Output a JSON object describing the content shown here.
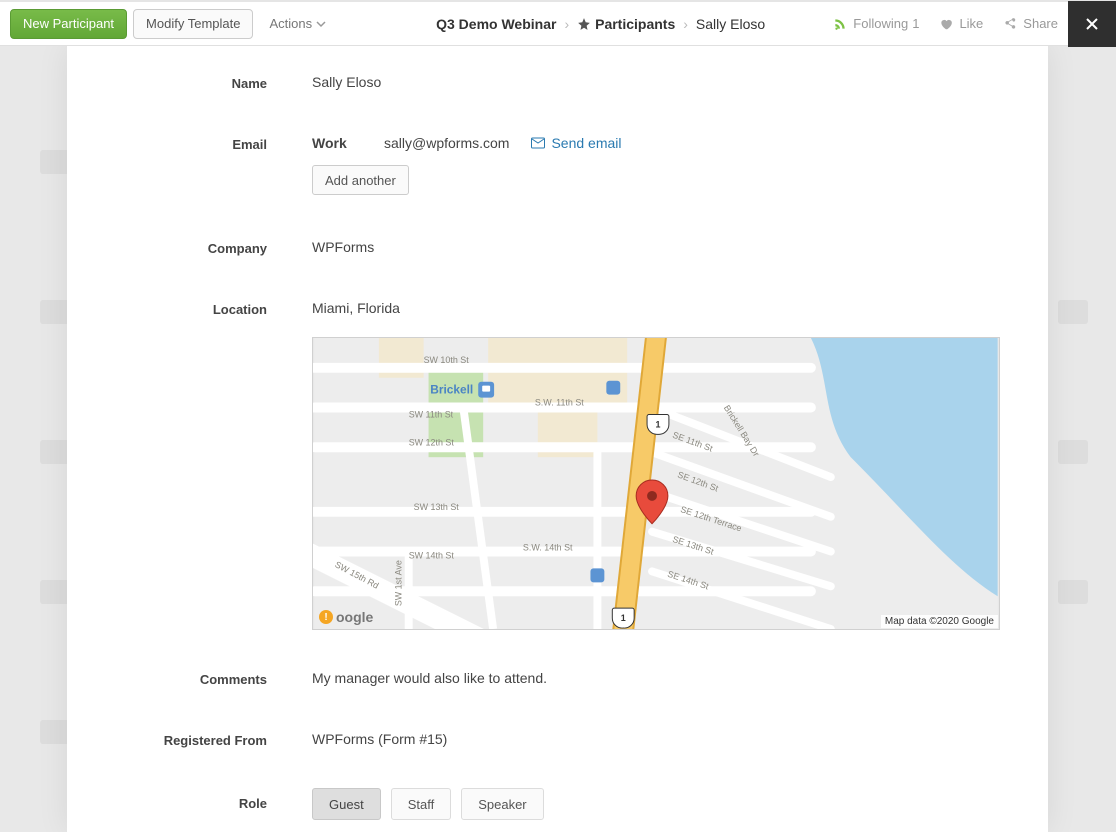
{
  "toolbar": {
    "new_label": "New Participant",
    "modify_label": "Modify Template",
    "actions_label": "Actions"
  },
  "breadcrumb": {
    "root": "Q3 Demo Webinar",
    "section": "Participants",
    "leaf": "Sally Eloso"
  },
  "right": {
    "following_label": "Following",
    "following_count": "1",
    "like_label": "Like",
    "share_label": "Share"
  },
  "fields": {
    "name_label": "Name",
    "name_value": "Sally Eloso",
    "email_label": "Email",
    "email_type": "Work",
    "email_value": "sally@wpforms.com",
    "send_email": "Send email",
    "add_another": "Add another",
    "company_label": "Company",
    "company_value": "WPForms",
    "location_label": "Location",
    "location_value": "Miami, Florida",
    "comments_label": "Comments",
    "comments_value": "My manager would also like to attend.",
    "registered_from_label": "Registered From",
    "registered_from_value": "WPForms (Form #15)",
    "role_label": "Role"
  },
  "roles": {
    "guest": "Guest",
    "staff": "Staff",
    "speaker": "Speaker"
  },
  "map": {
    "station": "Brickell",
    "attribution": "Map data ©2020 Google",
    "logo": "oogle",
    "streets": {
      "sw10": "SW 10th St",
      "sw11": "SW 11th St",
      "sw11b": "S.W. 11th St",
      "sw12": "SW 12th St",
      "sw13": "SW 13th St",
      "sw14": "SW 14th St",
      "sw14b": "S.W. 14th St",
      "sw15rd": "SW 15th Rd",
      "se11": "SE 11th St",
      "se12": "SE 12th St",
      "se12ter": "SE 12th Terrace",
      "se13": "SE 13th St",
      "se14": "SE 14th St",
      "brickellbay": "Brickell Bay Dr",
      "sw1ave": "SW 1st Ave",
      "us1": "1"
    }
  }
}
